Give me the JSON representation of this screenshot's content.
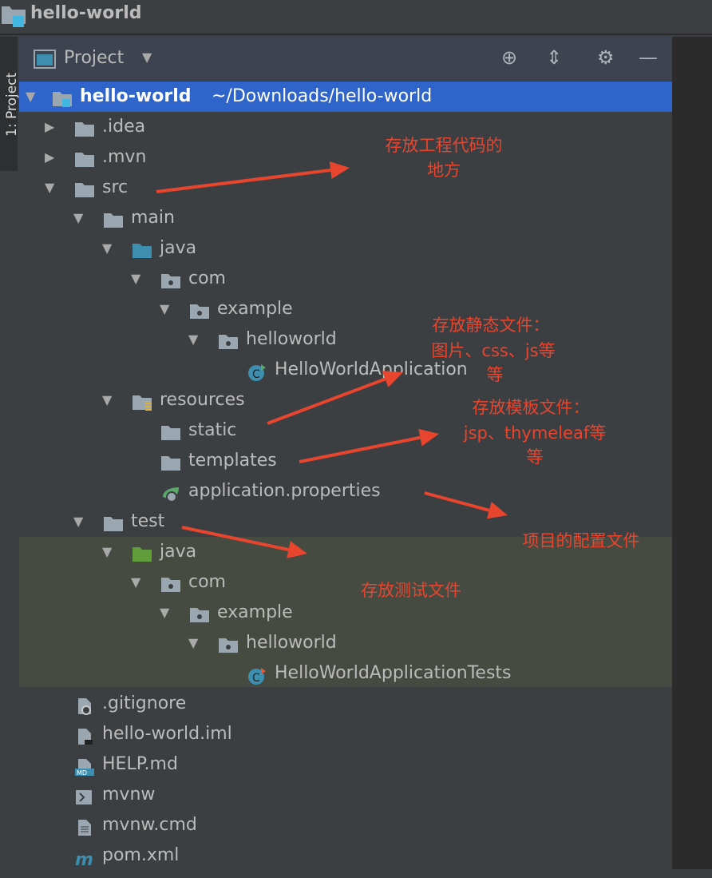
{
  "window": {
    "title": "hello-world"
  },
  "side_tab": {
    "label": "1: Project"
  },
  "panel": {
    "view_label": "Project",
    "icons": [
      "locate-icon",
      "collapse-all-icon",
      "gear-icon",
      "minimize-icon"
    ]
  },
  "tree": [
    {
      "label": "hello-world",
      "suffix": "~/Downloads/hello-world",
      "level": 0,
      "arrow": "down",
      "icon": "module",
      "selected": true
    },
    {
      "label": ".idea",
      "level": 1,
      "arrow": "right",
      "icon": "folder"
    },
    {
      "label": ".mvn",
      "level": 1,
      "arrow": "right",
      "icon": "folder"
    },
    {
      "label": "src",
      "level": 1,
      "arrow": "down",
      "icon": "folder"
    },
    {
      "label": "main",
      "level": 2,
      "arrow": "down",
      "icon": "folder"
    },
    {
      "label": "java",
      "level": 3,
      "arrow": "down",
      "icon": "source-folder"
    },
    {
      "label": "com",
      "level": 4,
      "arrow": "down",
      "icon": "package"
    },
    {
      "label": "example",
      "level": 5,
      "arrow": "down",
      "icon": "package"
    },
    {
      "label": "helloworld",
      "level": 6,
      "arrow": "down",
      "icon": "package"
    },
    {
      "label": "HelloWorldApplication",
      "level": 7,
      "arrow": "none",
      "icon": "spring-class"
    },
    {
      "label": "resources",
      "level": 3,
      "arrow": "down",
      "icon": "resources-folder"
    },
    {
      "label": "static",
      "level": 4,
      "arrow": "none",
      "icon": "folder"
    },
    {
      "label": "templates",
      "level": 4,
      "arrow": "none",
      "icon": "folder"
    },
    {
      "label": "application.properties",
      "level": 4,
      "arrow": "none",
      "icon": "spring-properties"
    },
    {
      "label": "test",
      "level": 2,
      "arrow": "down",
      "icon": "folder"
    },
    {
      "label": "java",
      "level": 3,
      "arrow": "down",
      "icon": "test-folder"
    },
    {
      "label": "com",
      "level": 4,
      "arrow": "down",
      "icon": "package"
    },
    {
      "label": "example",
      "level": 5,
      "arrow": "down",
      "icon": "package"
    },
    {
      "label": "helloworld",
      "level": 6,
      "arrow": "down",
      "icon": "package"
    },
    {
      "label": "HelloWorldApplicationTests",
      "level": 7,
      "arrow": "none",
      "icon": "test-class"
    },
    {
      "label": ".gitignore",
      "level": 1,
      "arrow": "none",
      "icon": "ignored-file"
    },
    {
      "label": "hello-world.iml",
      "level": 1,
      "arrow": "none",
      "icon": "iml-file"
    },
    {
      "label": "HELP.md",
      "level": 1,
      "arrow": "none",
      "icon": "markdown-file"
    },
    {
      "label": "mvnw",
      "level": 1,
      "arrow": "none",
      "icon": "shell-file"
    },
    {
      "label": "mvnw.cmd",
      "level": 1,
      "arrow": "none",
      "icon": "text-file"
    },
    {
      "label": "pom.xml",
      "level": 1,
      "arrow": "none",
      "icon": "maven-file"
    }
  ],
  "annotations": {
    "src": [
      "存放工程代码的",
      "地方"
    ],
    "static": [
      "存放静态文件：",
      "图片、css、js等",
      "等"
    ],
    "templates": [
      "存放模板文件：",
      "jsp、thymeleaf等",
      "等"
    ],
    "properties": [
      "项目的配置文件"
    ],
    "test": [
      "存放测试文件"
    ]
  },
  "colors": {
    "selection": "#2f65ca",
    "annotation": "#e8452f",
    "test_band": "#464b42"
  }
}
